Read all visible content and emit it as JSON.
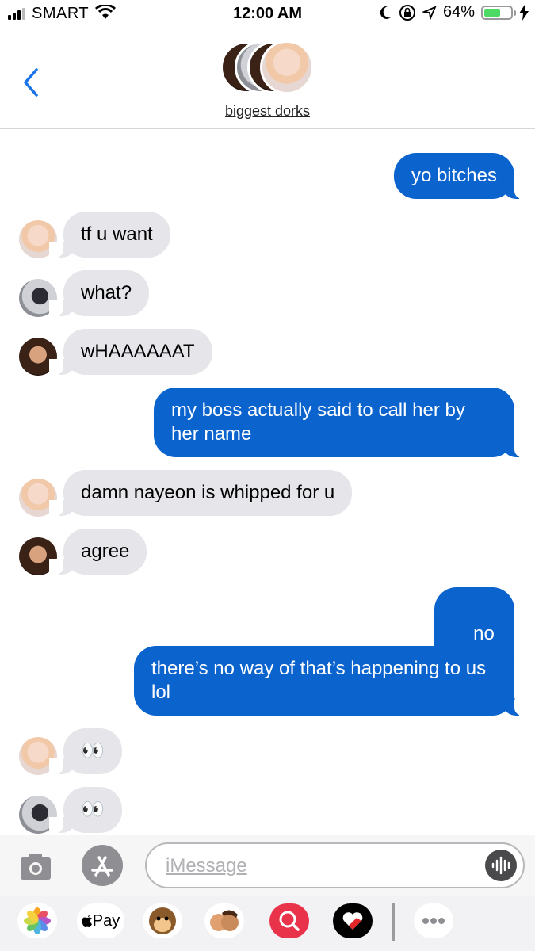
{
  "status_bar": {
    "carrier": "SMART",
    "time": "12:00 AM",
    "battery_percent_text": "64%",
    "battery_level": 0.64
  },
  "header": {
    "group_name": "biggest dorks"
  },
  "messages": [
    {
      "side": "sent",
      "text": "yo bitches"
    },
    {
      "side": "received",
      "text": "tf u want",
      "avatar": "member-a"
    },
    {
      "side": "received",
      "text": "what?",
      "avatar": "member-b"
    },
    {
      "side": "received",
      "text": "wHAAAAAAT",
      "avatar": "member-c"
    },
    {
      "side": "sent",
      "text": "my boss actually said to call her by her name"
    },
    {
      "side": "received",
      "text": "damn nayeon is whipped for u",
      "avatar": "member-a"
    },
    {
      "side": "received",
      "text": "agree",
      "avatar": "member-c"
    },
    {
      "side": "sent",
      "text": "no",
      "emoji": "❤️"
    },
    {
      "side": "sent",
      "text": "there’s no way of that’s happening to us lol"
    },
    {
      "side": "received",
      "text": "👀",
      "avatar": "member-a"
    },
    {
      "side": "received",
      "text": "👀",
      "avatar": "member-b"
    }
  ],
  "input": {
    "placeholder": "iMessage"
  },
  "app_drawer": {
    "apple_pay_label": "Pay",
    "apps": [
      "photos-icon",
      "apple-pay-icon",
      "animoji-icon",
      "memoji-icon",
      "search-images-icon",
      "digital-touch-icon",
      "more-icon"
    ]
  },
  "colors": {
    "sent_bubble": "#0b63ce",
    "received_bubble": "#e5e5ea",
    "back_chevron": "#1a73e8",
    "battery_fill": "#4cd964"
  }
}
